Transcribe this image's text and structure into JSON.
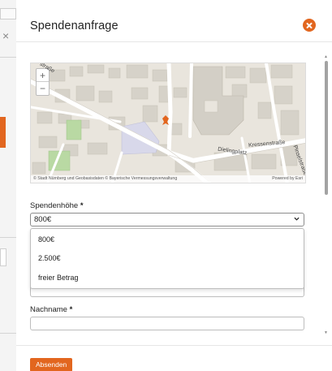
{
  "modal": {
    "title": "Spendenanfrage",
    "submit_label": "Absenden"
  },
  "map": {
    "attribution": "© Stadt Nürnberg und Geobasisdaten © Bayerische Vermessungsverwaltung",
    "powered_by": "Powered by Esri",
    "zoom_in": "+",
    "zoom_out": "−",
    "streets": [
      "Dielingplatz",
      "Kressenstraße",
      "Pinselstraße",
      "straße"
    ]
  },
  "form": {
    "donation_label": "Spendenhöhe",
    "donation_selected": "800€",
    "donation_options": [
      "800€",
      "2.500€",
      "freier Betrag"
    ],
    "lastname_label": "Nachname",
    "required_marker": "*"
  },
  "colors": {
    "accent": "#e2661f"
  }
}
